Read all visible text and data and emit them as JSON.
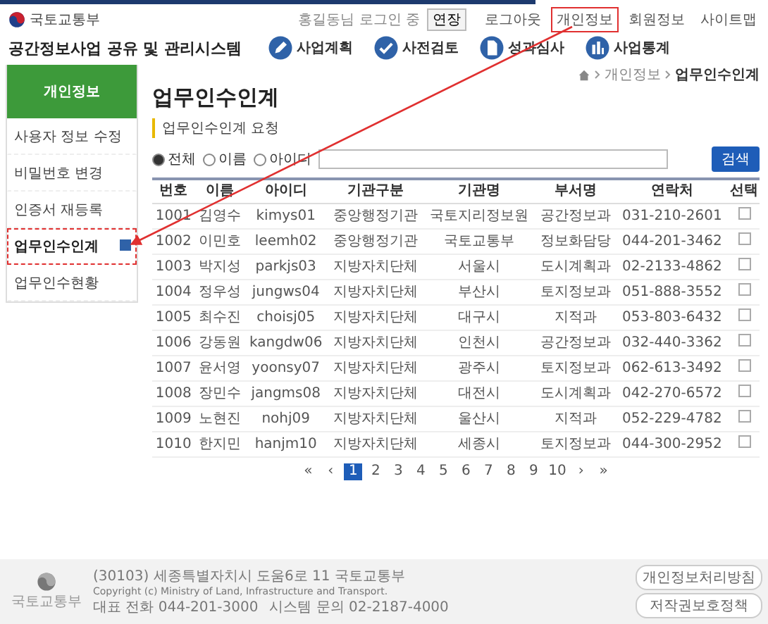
{
  "header": {
    "ministry": "국토교통부",
    "system_title": "공간정보사업 공유 및 관리시스템",
    "top_links": [
      {
        "label": "로그아웃",
        "highlighted": false
      },
      {
        "label": "개인정보",
        "highlighted": true
      },
      {
        "label": "회원정보",
        "highlighted": false
      },
      {
        "label": "사이트맵",
        "highlighted": false
      }
    ],
    "user_info": "홍길동님 로그인 중",
    "logout_timer": "연장",
    "nav": [
      "사업계획",
      "사전검토",
      "성과심사",
      "사업통계"
    ]
  },
  "sidebar": {
    "heading": "개인정보",
    "items": [
      {
        "label": "사용자 정보 수정",
        "selected": false,
        "highlighted": false
      },
      {
        "label": "비밀번호 변경",
        "selected": false,
        "highlighted": false
      },
      {
        "label": "인증서 재등록",
        "selected": false,
        "highlighted": false
      },
      {
        "label": "업무인수인계",
        "selected": true,
        "highlighted": true
      },
      {
        "label": "업무인수현황",
        "selected": false,
        "highlighted": false
      }
    ]
  },
  "breadcrumb": [
    "개인정보",
    "업무인수인계"
  ],
  "page_title": "업무인수인계",
  "section_title": "업무인수인계 요청",
  "search": {
    "options": [
      {
        "label": "전체",
        "selected": true
      },
      {
        "label": "이름",
        "selected": false
      },
      {
        "label": "아이디",
        "selected": false
      }
    ],
    "button": "검색"
  },
  "table": {
    "columns": [
      "번호",
      "이름",
      "아이디",
      "기관구분",
      "기관명",
      "부서명",
      "연락처",
      "선택"
    ],
    "rows": [
      [
        "1001",
        "김영수",
        "kimys01",
        "중앙행정기관",
        "국토지리정보원",
        "공간정보과",
        "031-210-2601"
      ],
      [
        "1002",
        "이민호",
        "leemh02",
        "중앙행정기관",
        "국토교통부",
        "정보화담당",
        "044-201-3462"
      ],
      [
        "1003",
        "박지성",
        "parkjs03",
        "지방자치단체",
        "서울시",
        "도시계획과",
        "02-2133-4862"
      ],
      [
        "1004",
        "정우성",
        "jungws04",
        "지방자치단체",
        "부산시",
        "토지정보과",
        "051-888-3552"
      ],
      [
        "1005",
        "최수진",
        "choisj05",
        "지방자치단체",
        "대구시",
        "지적과",
        "053-803-6432"
      ],
      [
        "1006",
        "강동원",
        "kangdw06",
        "지방자치단체",
        "인천시",
        "공간정보과",
        "032-440-3362"
      ],
      [
        "1007",
        "윤서영",
        "yoonsy07",
        "지방자치단체",
        "광주시",
        "토지정보과",
        "062-613-3492"
      ],
      [
        "1008",
        "장민수",
        "jangms08",
        "지방자치단체",
        "대전시",
        "도시계획과",
        "042-270-6572"
      ],
      [
        "1009",
        "노현진",
        "nohj09",
        "지방자치단체",
        "울산시",
        "지적과",
        "052-229-4782"
      ],
      [
        "1010",
        "한지민",
        "hanjm10",
        "지방자치단체",
        "세종시",
        "토지정보과",
        "044-300-2952"
      ]
    ],
    "checked": [
      false,
      false,
      false,
      false,
      false,
      false,
      false,
      false,
      false,
      false
    ]
  },
  "pagination": {
    "first": "«",
    "prev": "‹",
    "pages": [
      {
        "label": "1",
        "selected": true
      },
      {
        "label": "2",
        "selected": false
      },
      {
        "label": "3",
        "selected": false
      },
      {
        "label": "4",
        "selected": false
      },
      {
        "label": "5",
        "selected": false
      },
      {
        "label": "6",
        "selected": false
      },
      {
        "label": "7",
        "selected": false
      },
      {
        "label": "8",
        "selected": false
      },
      {
        "label": "9",
        "selected": false
      },
      {
        "label": "10",
        "selected": false
      }
    ],
    "next": "›",
    "last": "»"
  },
  "footer": {
    "logo_caption": "국토교통부",
    "address": "(30103) 세종특별자치시 도움6로 11 국토교통부",
    "copyright": "Copyright (c) Ministry of Land, Infrastructure and Transport.",
    "phones": [
      "대표 전화 044-201-3000",
      "시스템 문의 02-2187-4000"
    ],
    "buttons": [
      "개인정보처리방침",
      "저작권보호정책"
    ]
  }
}
